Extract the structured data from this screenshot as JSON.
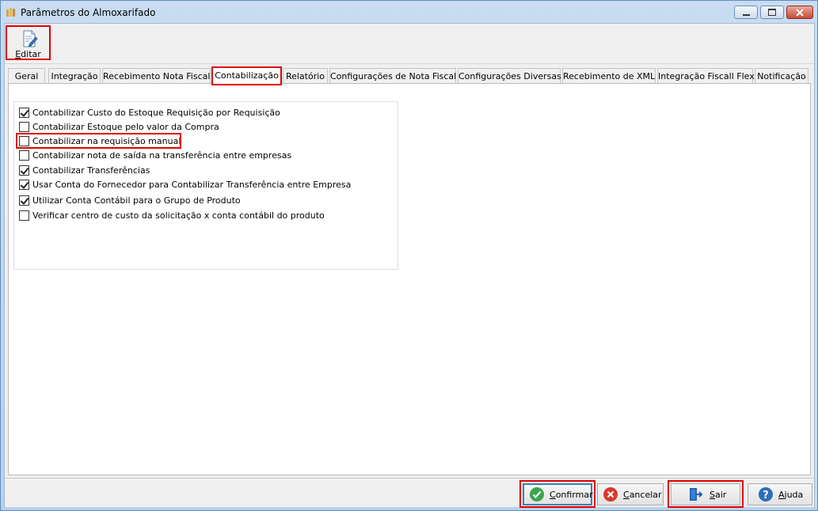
{
  "window": {
    "title": "Parâmetros do Almoxarifado"
  },
  "toolbar": {
    "edit_label": "Editar"
  },
  "tabs": [
    {
      "label": "Geral"
    },
    {
      "label": "Integração"
    },
    {
      "label": "Recebimento Nota Fiscal"
    },
    {
      "label": "Contabilização",
      "active": true
    },
    {
      "label": "Relatório"
    },
    {
      "label": "Configurações de Nota Fiscal"
    },
    {
      "label": "Configurações Diversas"
    },
    {
      "label": "Recebimento de XML"
    },
    {
      "label": "Integração Fiscall Flex"
    },
    {
      "label": "Notificação"
    }
  ],
  "options": [
    {
      "label": "Contabilizar Custo do Estoque Requisição por Requisição",
      "checked": true
    },
    {
      "label": "Contabilizar Estoque pelo valor da Compra",
      "checked": false
    },
    {
      "label": "Contabilizar na requisição manual",
      "checked": false
    },
    {
      "label": "Contabilizar nota de saída na transferência entre empresas",
      "checked": false
    },
    {
      "label": "Contabilizar Transferências",
      "checked": true
    },
    {
      "label": "Usar Conta do Fornecedor para Contabilizar Transferência entre Empresa",
      "checked": true
    },
    {
      "label": "Utilizar Conta Contábil para o Grupo de Produto",
      "checked": true
    },
    {
      "label": "Verificar centro de custo da solicitação x conta contábil do produto",
      "checked": false
    }
  ],
  "footer": {
    "confirm_label": "Confirmar",
    "cancel_label": "Cancelar",
    "exit_label": "Sair",
    "help_label": "Ajuda"
  },
  "colors": {
    "highlight": "#e00000",
    "title_bar": "#c9dcf1",
    "confirm_icon": "#3aa64c",
    "cancel_icon": "#d9382b",
    "help_icon": "#2d6fb7",
    "exit_icon": "#1f5fae"
  },
  "icons": {
    "edit": "edit-document-icon",
    "confirm": "check-circle-icon",
    "cancel": "cancel-circle-icon",
    "exit": "exit-door-icon",
    "help": "help-circle-icon"
  }
}
